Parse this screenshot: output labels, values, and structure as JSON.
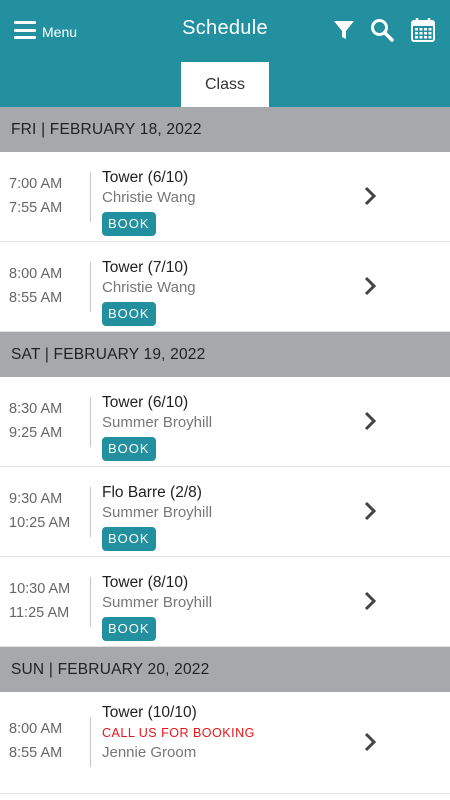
{
  "header": {
    "menu_label": "Menu",
    "title": "Schedule",
    "icons": [
      "hamburger-icon",
      "filter-icon",
      "search-icon",
      "calendar-icon"
    ]
  },
  "tabs": [
    {
      "label": "Class",
      "active": true
    }
  ],
  "colors": {
    "accent": "#23909f",
    "date_bar": "#a7a8ab",
    "alert": "#e8141b"
  },
  "days": [
    {
      "label": "FRI | FEBRUARY 18, 2022",
      "classes": [
        {
          "start": "7:00 AM",
          "end": "7:55 AM",
          "name": "Tower (6/10)",
          "instructor": "Christie Wang",
          "action": "BOOK"
        },
        {
          "start": "8:00 AM",
          "end": "8:55 AM",
          "name": "Tower (7/10)",
          "instructor": "Christie Wang",
          "action": "BOOK"
        }
      ]
    },
    {
      "label": "SAT | FEBRUARY 19, 2022",
      "classes": [
        {
          "start": "8:30 AM",
          "end": "9:25 AM",
          "name": "Tower (6/10)",
          "instructor": "Summer Broyhill",
          "action": "BOOK"
        },
        {
          "start": "9:30 AM",
          "end": "10:25 AM",
          "name": "Flo Barre (2/8)",
          "instructor": "Summer Broyhill",
          "action": "BOOK"
        },
        {
          "start": "10:30 AM",
          "end": "11:25 AM",
          "name": "Tower (8/10)",
          "instructor": "Summer Broyhill",
          "action": "BOOK"
        }
      ]
    },
    {
      "label": "SUN | FEBRUARY 20, 2022",
      "classes": [
        {
          "start": "8:00 AM",
          "end": "8:55 AM",
          "name": "Tower (10/10)",
          "notice": "CALL US FOR BOOKING",
          "instructor": "Jennie Groom"
        }
      ]
    }
  ]
}
